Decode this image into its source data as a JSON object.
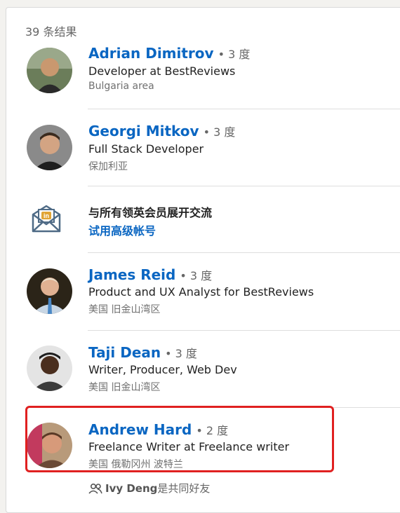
{
  "results_count": "39 条结果",
  "people": [
    {
      "name": "Adrian Dimitrov",
      "degree": "• 3 度",
      "headline": "Developer at BestReviews",
      "location": "Bulgaria area"
    },
    {
      "name": "Georgi Mitkov",
      "degree": "• 3 度",
      "headline": "Full Stack Developer",
      "location": "保加利亚"
    },
    {
      "name": "James Reid",
      "degree": "• 3 度",
      "headline": "Product and UX Analyst for BestReviews",
      "location": "美国 旧金山湾区"
    },
    {
      "name": "Taji Dean",
      "degree": "• 3 度",
      "headline": "Writer, Producer, Web Dev",
      "location": "美国 旧金山湾区"
    },
    {
      "name": "Andrew Hard",
      "degree": "• 2 度",
      "headline": "Freelance Writer at Freelance writer",
      "location": "美国 俄勒冈州 波特兰"
    }
  ],
  "promo": {
    "title": "与所有领英会员展开交流",
    "link": "试用高级帐号",
    "icon": "linkedin-mail-icon"
  },
  "mutual": {
    "name": "Ivy Deng",
    "text": "是共同好友",
    "icon": "people-icon"
  },
  "colors": {
    "link": "#0a66c2",
    "highlight": "#e02020"
  }
}
